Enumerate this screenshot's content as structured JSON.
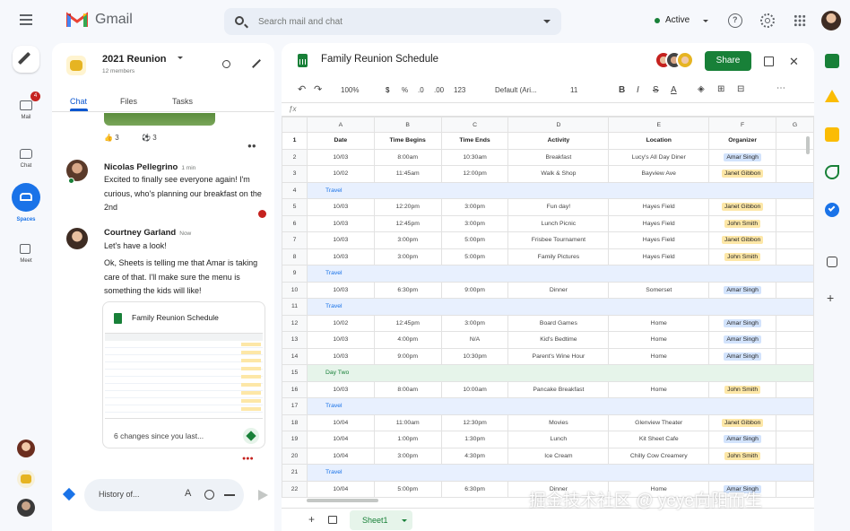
{
  "app": {
    "name": "Gmail"
  },
  "search": {
    "placeholder": "Search mail and chat"
  },
  "status": {
    "label": "Active",
    "color": "#188038"
  },
  "rail": {
    "items": [
      {
        "label": "Mail",
        "icon": "mail-icon",
        "badge": "4"
      },
      {
        "label": "Chat",
        "icon": "chat-icon"
      },
      {
        "label": "Spaces",
        "icon": "spaces-icon"
      },
      {
        "label": "Meet",
        "icon": "video-icon"
      }
    ]
  },
  "chat": {
    "space_name": "2021 Reunion",
    "member_count": "12 members",
    "tabs": [
      "Chat",
      "Files",
      "Tasks"
    ],
    "reactions": [
      {
        "emoji": "👍",
        "count": "3"
      },
      {
        "emoji": "⚽",
        "count": "3"
      }
    ],
    "messages": [
      {
        "sender": "Nicolas Pellegrino",
        "time": "1 min",
        "text": "Excited to finally see everyone again! I'm curious, who's planning our breakfast on the 2nd"
      },
      {
        "sender": "Courtney Garland",
        "time": "Now",
        "lines": [
          "Let's have a look!",
          "Ok, Sheets is telling me that Amar is taking care of that. I'll make sure the menu is something the kids will like!"
        ]
      }
    ],
    "card": {
      "title": "Family Reunion Schedule",
      "footer": "6 changes since you last..."
    },
    "input_placeholder": "History of..."
  },
  "sheet": {
    "title": "Family Reunion Schedule",
    "share_label": "Share",
    "toolbar": {
      "zoom": "100%",
      "format": "123",
      "font": "Default (Ari...",
      "font_size": "11"
    },
    "tab_label": "Sheet1",
    "columns": [
      "A",
      "B",
      "C",
      "D",
      "E",
      "F",
      "G"
    ],
    "rows": [
      {
        "n": "1",
        "type": "header",
        "cells": [
          "Date",
          "Time Begins",
          "Time Ends",
          "Activity",
          "Location",
          "Organizer"
        ]
      },
      {
        "n": "2",
        "type": "data",
        "cells": [
          "10/03",
          "8:00am",
          "10:30am",
          "Breakfast",
          "Lucy's All Day Diner",
          "Amar Singh"
        ],
        "org": "blue"
      },
      {
        "n": "3",
        "type": "data",
        "cells": [
          "10/02",
          "11:45am",
          "12:00pm",
          "Walk & Shop",
          "Bayview Ave",
          "Janet Gibbon"
        ],
        "org": "yellow"
      },
      {
        "n": "4",
        "type": "section",
        "label": "Travel"
      },
      {
        "n": "5",
        "type": "data",
        "cells": [
          "10/03",
          "12:20pm",
          "3:00pm",
          "Fun day!",
          "Hayes Field",
          "Janet Gibbon"
        ],
        "org": "yellow"
      },
      {
        "n": "6",
        "type": "data",
        "cells": [
          "10/03",
          "12:45pm",
          "3:00pm",
          "Lunch Picnic",
          "Hayes Field",
          "John Smith"
        ],
        "org": "yellow"
      },
      {
        "n": "7",
        "type": "data",
        "cells": [
          "10/03",
          "3:00pm",
          "5:00pm",
          "Frisbee Tournament",
          "Hayes Field",
          "Janet Gibbon"
        ],
        "org": "yellow"
      },
      {
        "n": "8",
        "type": "data",
        "cells": [
          "10/03",
          "3:00pm",
          "5:00pm",
          "Family Pictures",
          "Hayes Field",
          "John Smith"
        ],
        "org": "yellow"
      },
      {
        "n": "9",
        "type": "section",
        "label": "Travel"
      },
      {
        "n": "10",
        "type": "data",
        "cells": [
          "10/03",
          "6:30pm",
          "9:00pm",
          "Dinner",
          "Somerset",
          "Amar Singh"
        ],
        "org": "blue"
      },
      {
        "n": "11",
        "type": "section",
        "label": "Travel"
      },
      {
        "n": "12",
        "type": "data",
        "cells": [
          "10/02",
          "12:45pm",
          "3:00pm",
          "Board Games",
          "Home",
          "Amar Singh"
        ],
        "org": "blue"
      },
      {
        "n": "13",
        "type": "data",
        "cells": [
          "10/03",
          "4:00pm",
          "N/A",
          "Kid's Bedtime",
          "Home",
          "Amar Singh"
        ],
        "org": "blue"
      },
      {
        "n": "14",
        "type": "data",
        "cells": [
          "10/03",
          "9:00pm",
          "10:30pm",
          "Parent's Wine Hour",
          "Home",
          "Amar Singh"
        ],
        "org": "blue"
      },
      {
        "n": "15",
        "type": "day",
        "label": "Day Two"
      },
      {
        "n": "16",
        "type": "data",
        "cells": [
          "10/03",
          "8:00am",
          "10:00am",
          "Pancake Breakfast",
          "Home",
          "John Smith"
        ],
        "org": "yellow"
      },
      {
        "n": "17",
        "type": "section",
        "label": "Travel"
      },
      {
        "n": "18",
        "type": "data",
        "cells": [
          "10/04",
          "11:00am",
          "12:30pm",
          "Movies",
          "Glenview Theater",
          "Janet Gibbon"
        ],
        "org": "yellow"
      },
      {
        "n": "19",
        "type": "data",
        "cells": [
          "10/04",
          "1:00pm",
          "1:30pm",
          "Lunch",
          "Kit Sheet Cafe",
          "Amar Singh"
        ],
        "org": "blue"
      },
      {
        "n": "20",
        "type": "data",
        "cells": [
          "10/04",
          "3:00pm",
          "4:30pm",
          "Ice Cream",
          "Chilly Cow Creamery",
          "John Smith"
        ],
        "org": "yellow"
      },
      {
        "n": "21",
        "type": "section",
        "label": "Travel"
      },
      {
        "n": "22",
        "type": "data",
        "cells": [
          "10/04",
          "5:00pm",
          "6:30pm",
          "Dinner",
          "Home",
          "Amar Singh"
        ],
        "org": "blue"
      }
    ]
  },
  "watermark": "掘金技术社区 @ yeye向阳而生"
}
